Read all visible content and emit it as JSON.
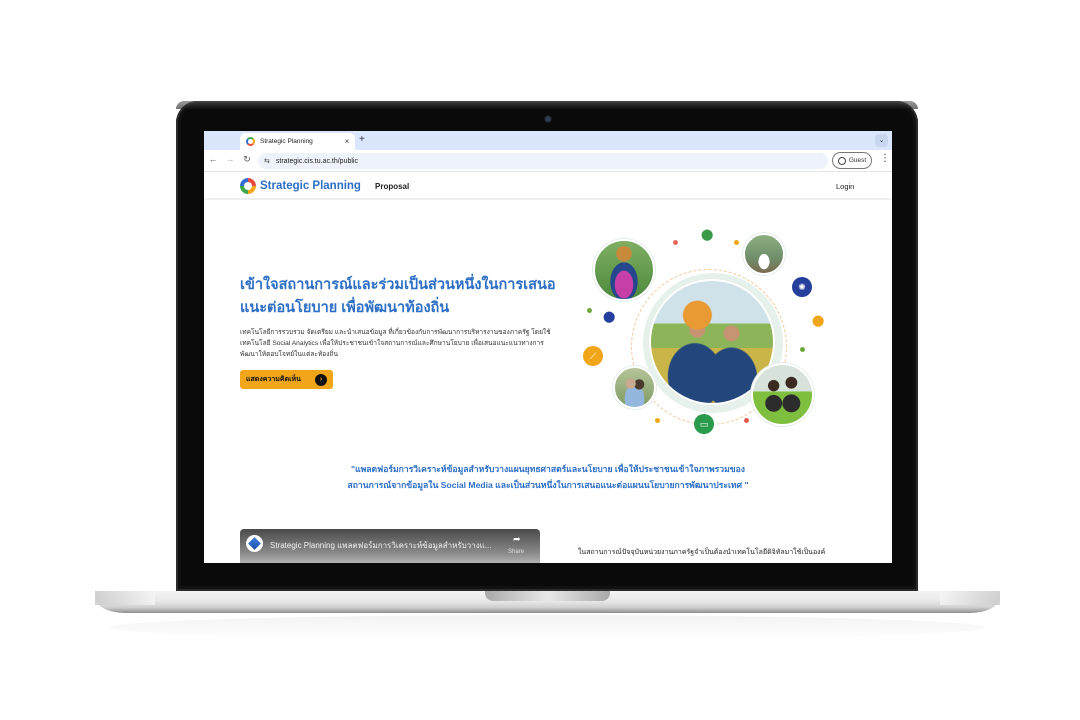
{
  "browser": {
    "tab_title": "Strategic Planning",
    "tab_close": "×",
    "new_tab": "+",
    "tab_dropdown": "⌄",
    "url": "strategic.cis.tu.ac.th/public",
    "site_info_icon": "⇆",
    "back": "←",
    "forward": "→",
    "reload": "↻",
    "profile_label": "Guest",
    "menu": "⋮"
  },
  "site": {
    "brand": "Strategic Planning",
    "nav": {
      "proposal": "Proposal",
      "login": "Login"
    },
    "accent_color": "#2c6fc5",
    "cta_color": "#f0a618"
  },
  "hero": {
    "title": "เข้าใจสถานการณ์และร่วมเป็นส่วนหนึ่งในการเสนอแนะต่อนโยบาย เพื่อพัฒนาท้องถิ่น",
    "description": "เทคโนโลยีการรวบรวม จัดเตรียม และนำเสนอข้อมูล ที่เกี่ยวข้องกับการพัฒนาการบริหารงานของภาครัฐ โดยใช้เทคโนโลยี Social Analytics เพื่อให้ประชาชนเข้าใจสถานการณ์และศึกษานโยบาย เพื่อเสนอแนะแนวทางการพัฒนาให้ตอบโจทย์ในแต่ละท้องถิ่น",
    "cta_label": "แสดงความคิดเห็น",
    "cta_arrow": "›"
  },
  "collage": {
    "badges": {
      "idea": "✺",
      "chart": "⟋",
      "chat": "▭"
    },
    "pin": "⬤"
  },
  "quote": "\"แพลตฟอร์มการวิเคราะห์ข้อมูลสำหรับวางแผนยุทธศาสตร์และนโยบาย เพื่อให้ประชาชนเข้าใจภาพรวมของสถานการณ์จากข้อมูลใน Social Media และเป็นส่วนหนึ่งในการเสนอแนะต่อแผนนโยบายการพัฒนาประเทศ \"",
  "video": {
    "title": "Strategic Planning แพลตฟอร์มการวิเคราะห์ข้อมูลสำหรับวางแ...",
    "share_icon": "➦",
    "share_label": "Share"
  },
  "intro_text": "ในสถานการณ์ปัจจุบันหน่วยงานภาครัฐจำเป็นต้องนำเทคโนโลยีดิจิทัลมาใช้เป็นองค์"
}
